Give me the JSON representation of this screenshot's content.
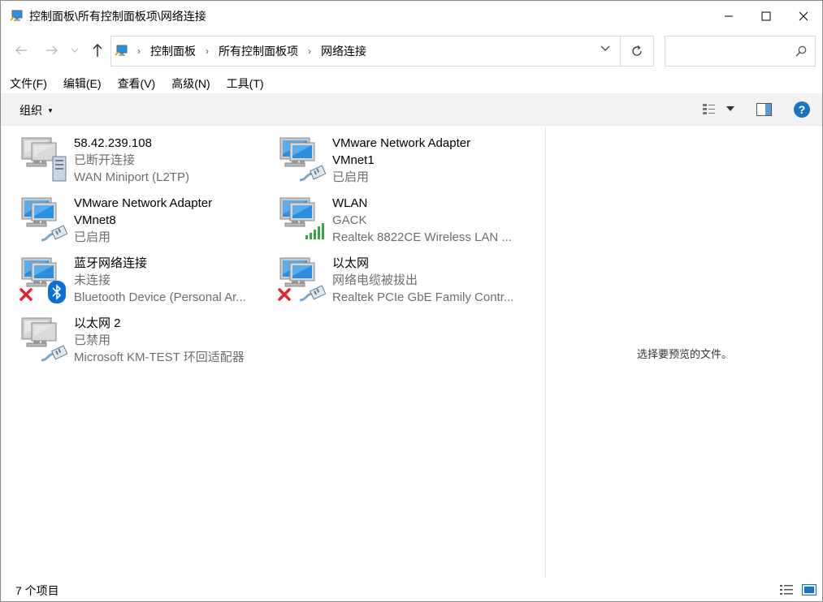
{
  "window": {
    "title": "控制面板\\所有控制面板项\\网络连接"
  },
  "address": {
    "crumbs": [
      "控制面板",
      "所有控制面板项",
      "网络连接"
    ],
    "search_placeholder": ""
  },
  "menu": {
    "items": [
      "文件(F)",
      "编辑(E)",
      "查看(V)",
      "高级(N)",
      "工具(T)"
    ]
  },
  "toolbar": {
    "organize_label": "组织"
  },
  "connections": [
    {
      "name": "58.42.239.108",
      "name2": "",
      "status": "已断开连接",
      "device": "WAN Miniport (L2TP)",
      "icon": "vpn-server-icon",
      "overlay": "none"
    },
    {
      "name": "VMware Network Adapter",
      "name2": "VMnet1",
      "status": "已启用",
      "device": "",
      "icon": "ethernet-cable-icon",
      "overlay": "none"
    },
    {
      "name": "VMware Network Adapter",
      "name2": "VMnet8",
      "status": "已启用",
      "device": "",
      "icon": "ethernet-cable-icon",
      "overlay": "none"
    },
    {
      "name": "WLAN",
      "name2": "",
      "status": "GACK",
      "device": "Realtek 8822CE Wireless LAN ...",
      "icon": "wifi-signal-icon",
      "overlay": "none"
    },
    {
      "name": "蓝牙网络连接",
      "name2": "",
      "status": "未连接",
      "device": "Bluetooth Device (Personal Ar...",
      "icon": "bluetooth-icon",
      "overlay": "red-x"
    },
    {
      "name": "以太网",
      "name2": "",
      "status": "网络电缆被拔出",
      "device": "Realtek PCIe GbE Family Contr...",
      "icon": "ethernet-cable-icon",
      "overlay": "red-x"
    },
    {
      "name": "以太网 2",
      "name2": "",
      "status": "已禁用",
      "device": "Microsoft KM-TEST 环回适配器",
      "icon": "ethernet-cable-icon",
      "overlay": "disabled"
    }
  ],
  "preview": {
    "text": "选择要预览的文件。"
  },
  "status": {
    "count": "7 个项目"
  },
  "colors": {
    "accent": "#1e73be",
    "monitor_blue": "#2b8ee0",
    "error_red": "#e0282e",
    "signal_green": "#3aa34a",
    "bluetooth_blue": "#0a6fd6"
  }
}
